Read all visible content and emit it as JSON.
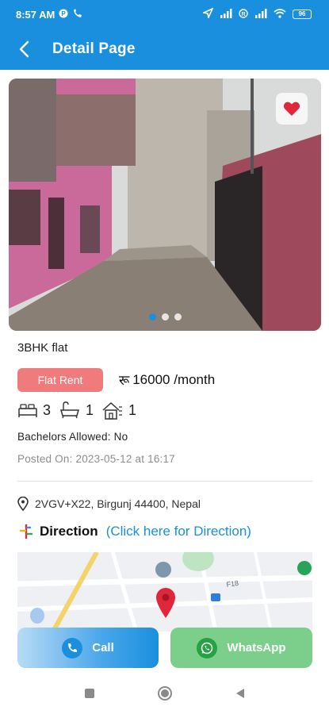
{
  "status_bar": {
    "time": "8:57 AM",
    "battery": "96"
  },
  "header": {
    "title": "Detail Page"
  },
  "gallery": {
    "slide_count": 3,
    "active_slide": 1,
    "is_favorite": true
  },
  "listing": {
    "title": "3BHK flat",
    "category_badge": "Flat Rent",
    "currency_symbol": "रू",
    "price": "16000 /month",
    "bedrooms": "3",
    "bathrooms": "1",
    "floors": "1",
    "bachelors": "Bachelors Allowed: No",
    "posted_on": "Posted On: 2023-05-12 at 16:17"
  },
  "location": {
    "address": "2VGV+X22, Birgunj 44400, Nepal",
    "direction_label": "Direction",
    "direction_link": "(Click here for Direction)",
    "map_road_label": "F18"
  },
  "actions": {
    "call_label": "Call",
    "whatsapp_label": "WhatsApp"
  },
  "colors": {
    "primary": "#1a8fde",
    "badge": "#f07b7d",
    "whatsapp": "#7ccf8a",
    "favorite": "#e0263a"
  }
}
